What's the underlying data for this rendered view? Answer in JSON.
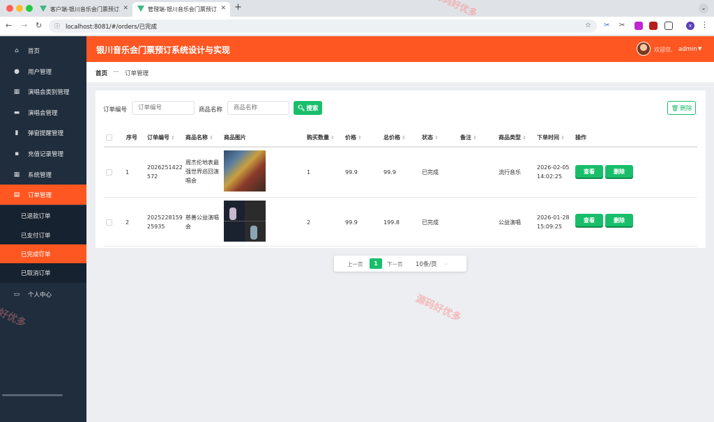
{
  "browser": {
    "tabs": [
      {
        "title": "客户端-银川音乐会门票预订系统设计与实现"
      },
      {
        "title": "管理端-银川音乐会门票预订系统设计与实现"
      }
    ],
    "url": "localhost:8081/#/orders/已完成",
    "profile_initial": "x"
  },
  "sidebar": {
    "items": [
      {
        "label": "首页",
        "icon": "home-icon"
      },
      {
        "label": "用户管理",
        "icon": "user-icon"
      },
      {
        "label": "演唱会类别管理",
        "icon": "grid-icon"
      },
      {
        "label": "演唱会管理",
        "icon": "briefcase-icon"
      },
      {
        "label": "弹窗提醒管理",
        "icon": "film-icon"
      },
      {
        "label": "充值记录管理",
        "icon": "wallet-icon"
      },
      {
        "label": "系统管理",
        "icon": "apps-icon"
      },
      {
        "label": "订单管理",
        "icon": "order-icon"
      }
    ],
    "subitems": [
      {
        "label": "已退款订单"
      },
      {
        "label": "已支付订单"
      },
      {
        "label": "已完成订单"
      },
      {
        "label": "已取消订单"
      }
    ],
    "personal": {
      "label": "个人中心",
      "icon": "profile-icon"
    }
  },
  "header": {
    "title": "银川音乐会门票预订系统设计与实现",
    "welcome": "欢迎您,",
    "username": "admin"
  },
  "breadcrumb": {
    "home": "首页",
    "separator": "—",
    "current": "订单管理"
  },
  "search": {
    "order_no_label": "订单编号",
    "order_no_placeholder": "订单编号",
    "product_label": "商品名称",
    "product_placeholder": "商品名称",
    "search_button": "搜索",
    "delete_button": "删除"
  },
  "table": {
    "headers": [
      "序号",
      "订单编号",
      "商品名称",
      "商品图片",
      "购买数量",
      "价格",
      "总价格",
      "状态",
      "备注",
      "商品类型",
      "下单时间",
      "操作"
    ],
    "rows": [
      {
        "index": "1",
        "order_no": [
          "2026251422",
          "572"
        ],
        "product": [
          "周杰伦地表最",
          "强世界巡回演",
          "唱会"
        ],
        "qty": "1",
        "price": "99.9",
        "total": "99.9",
        "status": "已完成",
        "remark": "",
        "type": "流行音乐",
        "time": [
          "2026-02-05",
          "14:02:25"
        ],
        "view": "查看",
        "delete": "删除"
      },
      {
        "index": "2",
        "order_no": [
          "2025228159",
          "25935"
        ],
        "product": [
          "慈善公益演唱",
          "会"
        ],
        "qty": "2",
        "price": "99.9",
        "total": "199.8",
        "status": "已完成",
        "remark": "",
        "type": "公益演唱",
        "time": [
          "2026-01-28",
          "15:09:25"
        ],
        "view": "查看",
        "delete": "删除"
      }
    ]
  },
  "pagination": {
    "prev": "上一页",
    "current": "1",
    "next": "下一页",
    "page_size": "10条/页"
  },
  "watermark": "源码好优多",
  "colors": {
    "accent": "#ff5722",
    "success": "#19be6b",
    "sidebar": "#1f2d3d"
  }
}
